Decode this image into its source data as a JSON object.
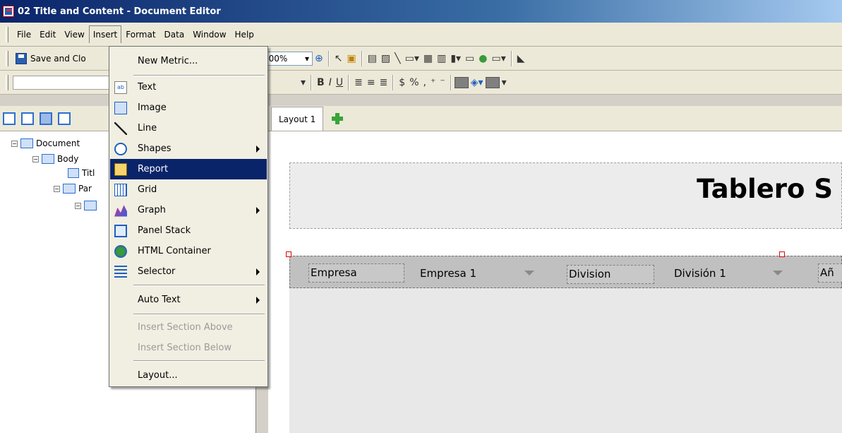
{
  "window": {
    "title": "02 Title and Content - Document Editor"
  },
  "menubar": {
    "items": [
      {
        "label": "File",
        "name": "menu-file"
      },
      {
        "label": "Edit",
        "name": "menu-edit"
      },
      {
        "label": "View",
        "name": "menu-view"
      },
      {
        "label": "Insert",
        "name": "menu-insert"
      },
      {
        "label": "Format",
        "name": "menu-format"
      },
      {
        "label": "Data",
        "name": "menu-data"
      },
      {
        "label": "Window",
        "name": "menu-window"
      },
      {
        "label": "Help",
        "name": "menu-help"
      }
    ]
  },
  "toolbar": {
    "save_label": "Save and Clo",
    "zoom_value": "100%"
  },
  "insert_menu": {
    "items": [
      {
        "label": "New Metric...",
        "icon": "none",
        "submenu": false
      },
      {
        "label": "Text",
        "icon": "text-icon",
        "submenu": false
      },
      {
        "label": "Image",
        "icon": "image-icon",
        "submenu": false
      },
      {
        "label": "Line",
        "icon": "line-icon",
        "submenu": false
      },
      {
        "label": "Shapes",
        "icon": "shapes-icon",
        "submenu": true
      },
      {
        "label": "Report",
        "icon": "report-icon",
        "submenu": false,
        "highlighted": true
      },
      {
        "label": "Grid",
        "icon": "grid-icon",
        "submenu": false
      },
      {
        "label": "Graph",
        "icon": "graph-icon",
        "submenu": true
      },
      {
        "label": "Panel Stack",
        "icon": "panel-stack-icon",
        "submenu": false
      },
      {
        "label": "HTML Container",
        "icon": "html-container-icon",
        "submenu": false
      },
      {
        "label": "Selector",
        "icon": "selector-icon",
        "submenu": true
      },
      {
        "label": "Auto Text",
        "icon": "none",
        "submenu": true
      },
      {
        "label": "Insert Section Above",
        "icon": "none",
        "submenu": false,
        "disabled": true
      },
      {
        "label": "Insert Section Below",
        "icon": "none",
        "submenu": false,
        "disabled": true
      },
      {
        "label": "Layout...",
        "icon": "none",
        "submenu": false
      }
    ]
  },
  "tree": {
    "document": "Document",
    "body": "Body",
    "title": "Titl",
    "panel": "Par"
  },
  "layout_tabs": {
    "tab1": "Layout 1"
  },
  "canvas": {
    "title_text": "Tablero S",
    "selectors": {
      "empresa_label": "Empresa",
      "empresa_value": "Empresa 1",
      "division_label": "Division",
      "division_value": "División 1",
      "anio_label": "Añ"
    }
  },
  "colors": {
    "highlight": "#0a246a",
    "titlebar": "#0a246a"
  }
}
